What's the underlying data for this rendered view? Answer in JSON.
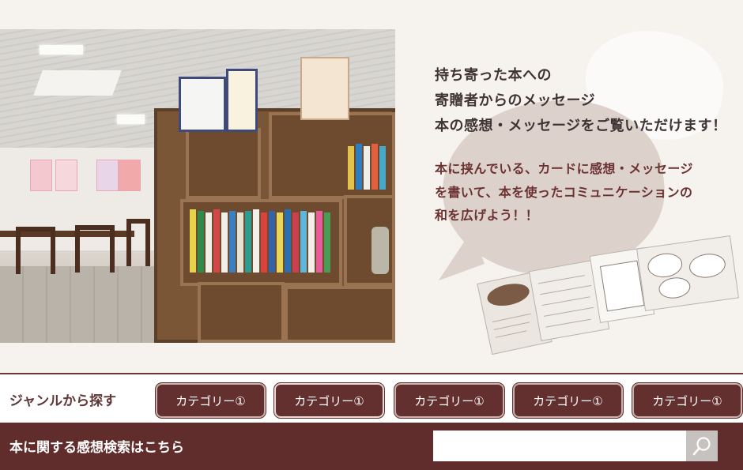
{
  "message": {
    "title_lines": [
      "持ち寄った本への",
      "寄贈者からのメッセージ",
      "本の感想・メッセージをご覧いただけます！"
    ],
    "body_lines": [
      "本に挟んでいる、カードに感想・メッセージ",
      "を書いて、本を使ったコミュニケーションの",
      "和を広げよう！！"
    ]
  },
  "genre": {
    "label": "ジャンルから探す",
    "buttons": [
      {
        "label": "カテゴリー①"
      },
      {
        "label": "カテゴリー①"
      },
      {
        "label": "カテゴリー①"
      },
      {
        "label": "カテゴリー①"
      },
      {
        "label": "カテゴリー①"
      }
    ]
  },
  "search": {
    "label": "本に関する感想検索はこちら",
    "placeholder": "",
    "value": ""
  },
  "icons": {
    "search_button": "search-icon"
  },
  "colors": {
    "brand_dark": "#63302f",
    "page_bg": "#f6f2ee",
    "accent_text": "#6b3231"
  }
}
